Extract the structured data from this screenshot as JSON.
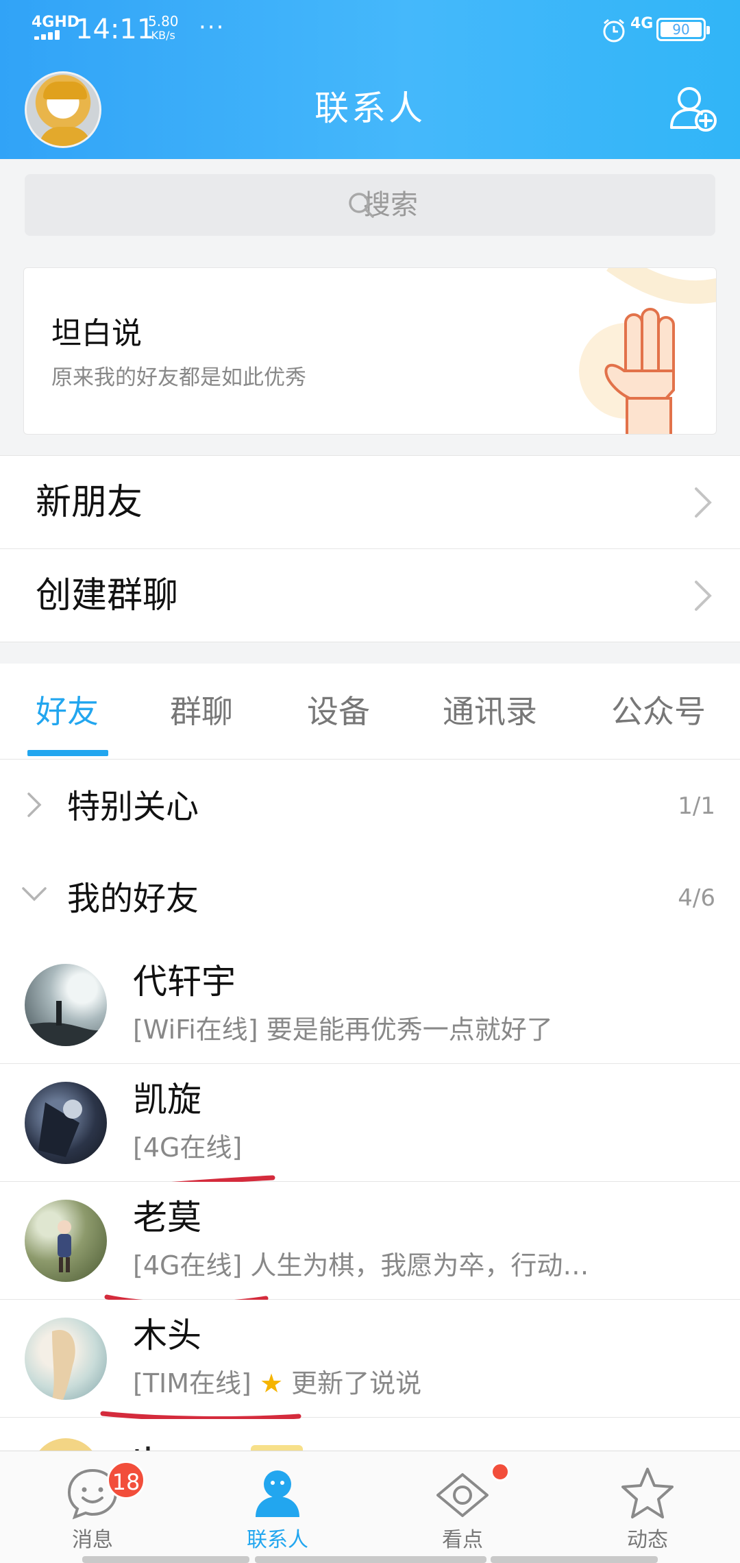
{
  "status_bar": {
    "network": "4GHD",
    "time": "14:11",
    "speed_value": "5.80",
    "speed_unit": "KB/s",
    "more": "···",
    "mobile": "4G",
    "battery": "90"
  },
  "header": {
    "title": "联系人"
  },
  "search": {
    "placeholder": "搜索"
  },
  "card": {
    "title": "坦白说",
    "subtitle": "原来我的好友都是如此优秀"
  },
  "menu": {
    "new_friends": "新朋友",
    "create_group": "创建群聊"
  },
  "tabs": [
    {
      "label": "好友",
      "active": true
    },
    {
      "label": "群聊",
      "active": false
    },
    {
      "label": "设备",
      "active": false
    },
    {
      "label": "通讯录",
      "active": false
    },
    {
      "label": "公众号",
      "active": false
    }
  ],
  "groups": {
    "special": {
      "name": "特别关心",
      "count": "1/1"
    },
    "friends": {
      "name": "我的好友",
      "count": "4/6"
    }
  },
  "contacts": [
    {
      "name": "代轩宇",
      "status": "[WiFi在线]",
      "message": " 要是能再优秀一点就好了"
    },
    {
      "name": "凯旋",
      "status": "[4G在线]",
      "message": ""
    },
    {
      "name": "老莫",
      "status": "[4G在线]",
      "message": " 人生为棋，我愿为卒，行动…"
    },
    {
      "name": "木头",
      "status": "[TIM在线]",
      "star": "★",
      "message": " 更新了说说"
    }
  ],
  "bottom_nav": [
    {
      "label": "消息",
      "badge": "18"
    },
    {
      "label": "联系人",
      "active": true
    },
    {
      "label": "看点"
    },
    {
      "label": "动态"
    }
  ],
  "colors": {
    "accent": "#22a6ef",
    "header_start": "#31a3f7",
    "badge": "#f24e3b",
    "scribble": "#d42b3c"
  }
}
